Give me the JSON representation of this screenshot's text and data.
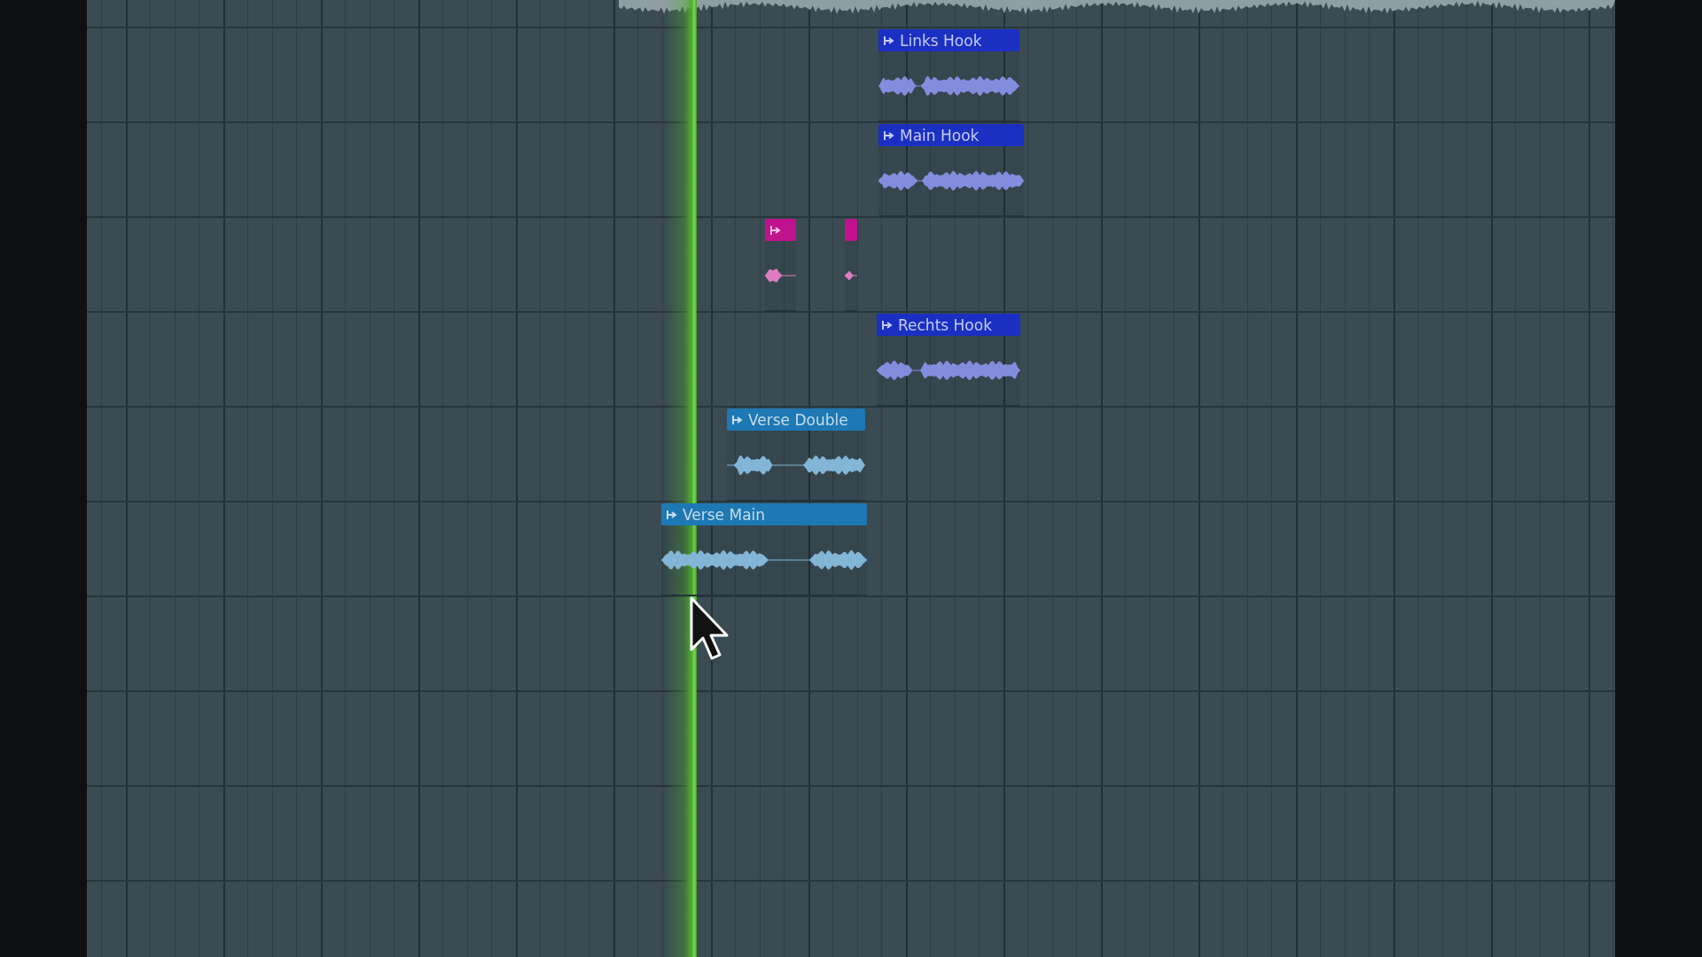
{
  "playlist": {
    "tracks": [
      {
        "clips": [
          {
            "name": "Links Hook",
            "color": "#1b2fc2"
          }
        ]
      },
      {
        "clips": [
          {
            "name": "Main Hook",
            "color": "#1b2fc2"
          }
        ]
      },
      {
        "clips": [
          {
            "color": "#c0128c"
          },
          {
            "color": "#c0128c"
          }
        ]
      },
      {
        "clips": [
          {
            "name": "Rechts Hook",
            "color": "#1b2fc2"
          }
        ]
      },
      {
        "clips": [
          {
            "name": "Verse Double",
            "color": "#1d78b4"
          }
        ]
      },
      {
        "clips": [
          {
            "name": "Verse Main",
            "color": "#1d78b4"
          }
        ]
      }
    ]
  }
}
